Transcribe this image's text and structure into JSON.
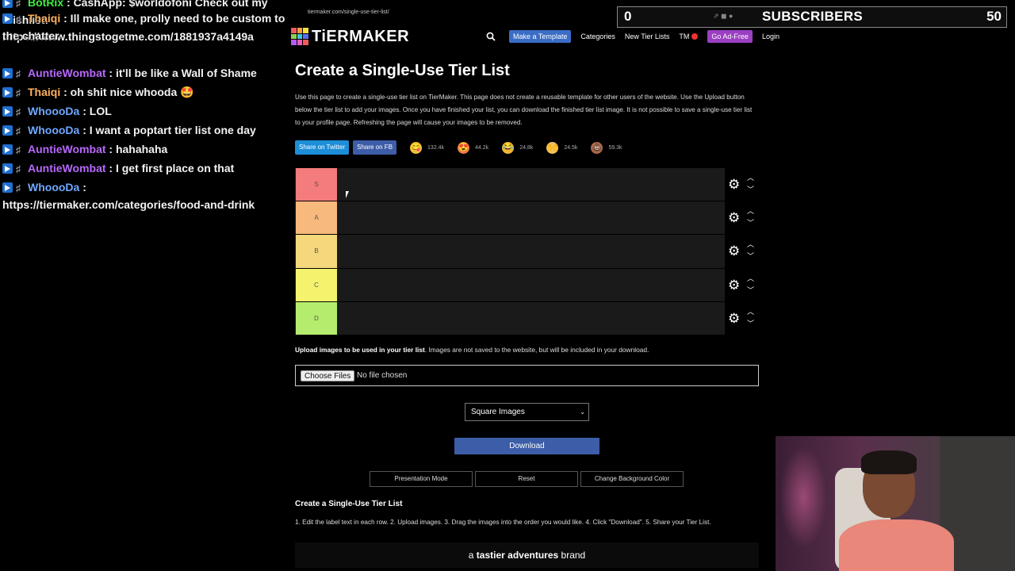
{
  "chat": {
    "messages": [
      {
        "user": "BotRix",
        "user_color": "#3ef03e",
        "text": ": CashApp: $worldofoni Check out my Wishlist: https://www.thingstogetme.com/1881937a4149a"
      },
      {
        "user": "Thaiqi",
        "user_color": "#ffb25e",
        "text": ": Ill make one, prolly need to be custom to the chatter"
      },
      {
        "user": "AuntieWombat",
        "user_color": "#b868ff",
        "text": ": it'll be like a Wall of Shame"
      },
      {
        "user": "Thaiqi",
        "user_color": "#ffb25e",
        "text": ": oh shit nice whooda 🤩"
      },
      {
        "user": "WhoooDa",
        "user_color": "#6fa8ff",
        "text": ": LOL"
      },
      {
        "user": "WhoooDa",
        "user_color": "#6fa8ff",
        "text": ": I want a poptart tier list one day"
      },
      {
        "user": "AuntieWombat",
        "user_color": "#b868ff",
        "text": ": hahahaha"
      },
      {
        "user": "AuntieWombat",
        "user_color": "#b868ff",
        "text": ": I get first place on that"
      },
      {
        "user": "WhoooDa",
        "user_color": "#6fa8ff",
        "text": ": https://tiermaker.com/categories/food-and-drink"
      }
    ]
  },
  "browser": {
    "url": "tiermaker.com/single-use-tier-list/"
  },
  "subscribers": {
    "count": "0",
    "label": "SUBSCRIBERS",
    "goal": "50"
  },
  "nav": {
    "logo_text": "TiERMAKER",
    "make_template": "Make a Template",
    "categories": "Categories",
    "new_tier_lists": "New Tier Lists",
    "tm": "TM",
    "ad_free": "Go Ad-Free",
    "login": "Login"
  },
  "page": {
    "title": "Create a Single-Use Tier List",
    "description": "Use this page to create a single-use tier list on TierMaker. This page does not create a reusable template for other users of the website. Use the Upload button below the tier list to add your images. Once you have finished your list, you can download the finished tier list image. It is not possible to save a single-use tier list to your profile page. Refreshing the page will cause your images to be removed."
  },
  "share": {
    "twitter": "Share on Twitter",
    "facebook": "Share on FB",
    "reactions": [
      {
        "emoji": "😋",
        "count": "132.4k",
        "color": "#f2c23a"
      },
      {
        "emoji": "😍",
        "count": "44.2k",
        "color": "#f07a4a"
      },
      {
        "emoji": "😂",
        "count": "24.8k",
        "color": "#f2b63a"
      },
      {
        "emoji": "🙌",
        "count": "24.5k",
        "color": "#f4c45a"
      },
      {
        "emoji": "💩",
        "count": "59.3k",
        "color": "#b06a4a"
      }
    ]
  },
  "tiers": [
    {
      "label": "S",
      "color": "#f47c7c"
    },
    {
      "label": "A",
      "color": "#f7b97c"
    },
    {
      "label": "B",
      "color": "#f5d77c"
    },
    {
      "label": "C",
      "color": "#f5f36e"
    },
    {
      "label": "D",
      "color": "#b5ec6e"
    }
  ],
  "upload": {
    "label_bold": "Upload images to be used in your tier list",
    "label_rest": ". Images are not saved to the website, but will be included in your download.",
    "choose_button": "Choose Files",
    "file_status": "No file chosen"
  },
  "image_mode": {
    "selected": "Square Images"
  },
  "download_label": "Download",
  "options": {
    "presentation": "Presentation Mode",
    "reset": "Reset",
    "background": "Change Background Color"
  },
  "steps": {
    "title": "Create a Single-Use Tier List",
    "text": "1. Edit the label text in each row. 2. Upload images. 3. Drag the images into the order you would like. 4. Click \"Download\". 5. Share your Tier List."
  },
  "brand_bar": {
    "prefix": "a ",
    "bold": "tastier adventures",
    "suffix": " brand"
  }
}
